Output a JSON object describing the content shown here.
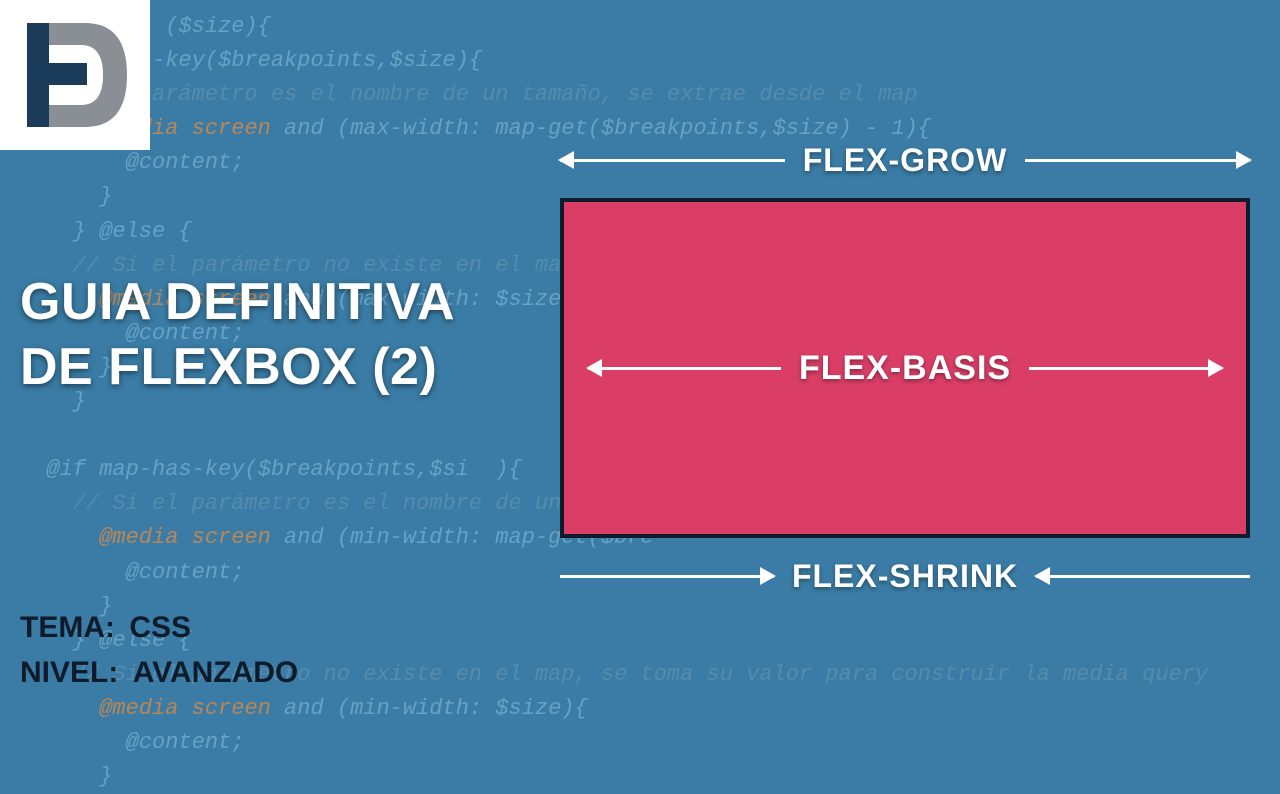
{
  "title_line1": "GUIA DEFINITIVA",
  "title_line2": "DE FLEXBOX (2)",
  "meta": {
    "tema_label": "TEMA:",
    "tema_value": "CSS",
    "nivel_label": "NIVEL:",
    "nivel_value": "AVANZADO"
  },
  "diagram": {
    "top_label": "FLEX-GROW",
    "center_label": "FLEX-BASIS",
    "bottom_label": "FLEX-SHRINK"
  },
  "colors": {
    "background": "#3a7ca5",
    "box_fill": "#da3e66",
    "box_border": "#0e1b2a",
    "text_light": "#ffffff",
    "text_dark": "#0e1b2a"
  }
}
